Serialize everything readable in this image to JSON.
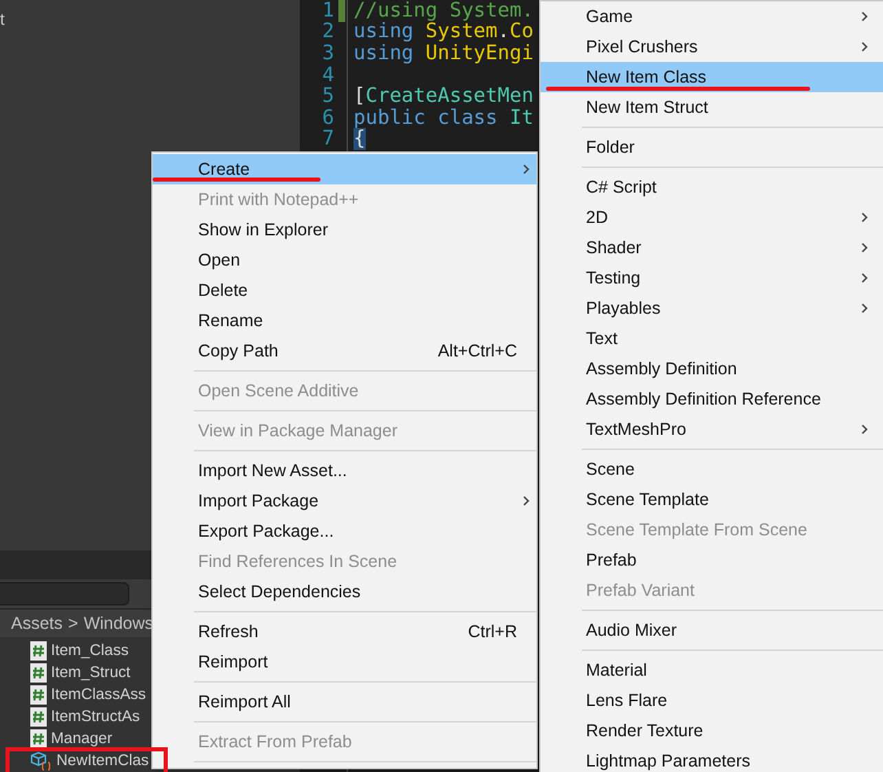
{
  "inspector_panel": {
    "text": "t"
  },
  "code_editor": {
    "lines": [
      {
        "number": "1",
        "changed": true,
        "selected": false,
        "tokens": [
          {
            "kind": "comment",
            "text": "//using System."
          }
        ]
      },
      {
        "number": "2",
        "changed": false,
        "selected": false,
        "tokens": [
          {
            "kind": "keyword",
            "text": "using"
          },
          {
            "kind": "type",
            "text": " System"
          },
          {
            "kind": "plain",
            "text": "."
          },
          {
            "kind": "type",
            "text": "Co"
          }
        ]
      },
      {
        "number": "3",
        "changed": false,
        "selected": false,
        "tokens": [
          {
            "kind": "keyword",
            "text": "using"
          },
          {
            "kind": "type",
            "text": " UnityEngi"
          }
        ]
      },
      {
        "number": "4",
        "changed": false,
        "selected": false
      },
      {
        "number": "5",
        "changed": false,
        "selected": false,
        "tokens": [
          {
            "kind": "plain",
            "text": "["
          },
          {
            "kind": "class",
            "text": "CreateAssetMen"
          }
        ]
      },
      {
        "number": "6",
        "changed": false,
        "selected": false,
        "tokens": [
          {
            "kind": "keyword",
            "text": "public"
          },
          {
            "kind": "keyword",
            "text": " class"
          },
          {
            "kind": "class",
            "text": " It"
          }
        ]
      },
      {
        "number": "7",
        "changed": false,
        "selected": true,
        "tokens": [
          {
            "kind": "plain",
            "text": "{"
          }
        ]
      }
    ]
  },
  "project_panel": {
    "breadcrumb": [
      {
        "label": "Assets"
      },
      {
        "label": "Windows"
      }
    ],
    "separator": ">",
    "assets": [
      {
        "name": "Item_Class",
        "kind": "script",
        "annotated": false
      },
      {
        "name": "Item_Struct",
        "kind": "script",
        "annotated": false
      },
      {
        "name": "ItemClassAss",
        "kind": "script",
        "annotated": false
      },
      {
        "name": "ItemStructAs",
        "kind": "script",
        "annotated": false
      },
      {
        "name": "Manager",
        "kind": "script",
        "annotated": false
      },
      {
        "name": "NewItemClas",
        "kind": "asset",
        "annotated": true
      }
    ]
  },
  "context_menu": {
    "items": [
      {
        "kind": "item",
        "label": "Create",
        "submenu": true,
        "disabled": false,
        "selected": true,
        "annotated": true
      },
      {
        "kind": "item",
        "label": "Print with Notepad++",
        "submenu": false,
        "disabled": true,
        "selected": false,
        "annotated": false
      },
      {
        "kind": "item",
        "label": "Show in Explorer",
        "submenu": false,
        "disabled": false,
        "selected": false,
        "annotated": false
      },
      {
        "kind": "item",
        "label": "Open",
        "submenu": false,
        "disabled": false,
        "selected": false,
        "annotated": false
      },
      {
        "kind": "item",
        "label": "Delete",
        "submenu": false,
        "disabled": false,
        "selected": false,
        "annotated": false
      },
      {
        "kind": "item",
        "label": "Rename",
        "submenu": false,
        "disabled": false,
        "selected": false,
        "annotated": false
      },
      {
        "kind": "item",
        "label": "Copy Path",
        "shortcut": "Alt+Ctrl+C",
        "submenu": false,
        "disabled": false,
        "selected": false,
        "annotated": false
      },
      {
        "kind": "separator"
      },
      {
        "kind": "item",
        "label": "Open Scene Additive",
        "submenu": false,
        "disabled": true,
        "selected": false,
        "annotated": false
      },
      {
        "kind": "separator"
      },
      {
        "kind": "item",
        "label": "View in Package Manager",
        "submenu": false,
        "disabled": true,
        "selected": false,
        "annotated": false
      },
      {
        "kind": "separator"
      },
      {
        "kind": "item",
        "label": "Import New Asset...",
        "submenu": false,
        "disabled": false,
        "selected": false,
        "annotated": false
      },
      {
        "kind": "item",
        "label": "Import Package",
        "submenu": true,
        "disabled": false,
        "selected": false,
        "annotated": false
      },
      {
        "kind": "item",
        "label": "Export Package...",
        "submenu": false,
        "disabled": false,
        "selected": false,
        "annotated": false
      },
      {
        "kind": "item",
        "label": "Find References In Scene",
        "submenu": false,
        "disabled": true,
        "selected": false,
        "annotated": false
      },
      {
        "kind": "item",
        "label": "Select Dependencies",
        "submenu": false,
        "disabled": false,
        "selected": false,
        "annotated": false
      },
      {
        "kind": "separator"
      },
      {
        "kind": "item",
        "label": "Refresh",
        "shortcut": "Ctrl+R",
        "submenu": false,
        "disabled": false,
        "selected": false,
        "annotated": false
      },
      {
        "kind": "item",
        "label": "Reimport",
        "submenu": false,
        "disabled": false,
        "selected": false,
        "annotated": false
      },
      {
        "kind": "separator"
      },
      {
        "kind": "item",
        "label": "Reimport All",
        "submenu": false,
        "disabled": false,
        "selected": false,
        "annotated": false
      },
      {
        "kind": "separator"
      },
      {
        "kind": "item",
        "label": "Extract From Prefab",
        "submenu": false,
        "disabled": true,
        "selected": false,
        "annotated": false
      },
      {
        "kind": "separator"
      }
    ]
  },
  "create_submenu": {
    "items": [
      {
        "kind": "item",
        "label": "Game",
        "submenu": true,
        "disabled": false,
        "selected": false,
        "annotated": false
      },
      {
        "kind": "item",
        "label": "Pixel Crushers",
        "submenu": true,
        "disabled": false,
        "selected": false,
        "annotated": false
      },
      {
        "kind": "item",
        "label": "New Item Class",
        "submenu": false,
        "disabled": false,
        "selected": true,
        "annotated": true
      },
      {
        "kind": "item",
        "label": "New Item Struct",
        "submenu": false,
        "disabled": false,
        "selected": false,
        "annotated": false
      },
      {
        "kind": "separator"
      },
      {
        "kind": "item",
        "label": "Folder",
        "submenu": false,
        "disabled": false,
        "selected": false,
        "annotated": false
      },
      {
        "kind": "separator"
      },
      {
        "kind": "item",
        "label": "C# Script",
        "submenu": false,
        "disabled": false,
        "selected": false,
        "annotated": false
      },
      {
        "kind": "item",
        "label": "2D",
        "submenu": true,
        "disabled": false,
        "selected": false,
        "annotated": false
      },
      {
        "kind": "item",
        "label": "Shader",
        "submenu": true,
        "disabled": false,
        "selected": false,
        "annotated": false
      },
      {
        "kind": "item",
        "label": "Testing",
        "submenu": true,
        "disabled": false,
        "selected": false,
        "annotated": false
      },
      {
        "kind": "item",
        "label": "Playables",
        "submenu": true,
        "disabled": false,
        "selected": false,
        "annotated": false
      },
      {
        "kind": "item",
        "label": "Text",
        "submenu": false,
        "disabled": false,
        "selected": false,
        "annotated": false
      },
      {
        "kind": "item",
        "label": "Assembly Definition",
        "submenu": false,
        "disabled": false,
        "selected": false,
        "annotated": false
      },
      {
        "kind": "item",
        "label": "Assembly Definition Reference",
        "submenu": false,
        "disabled": false,
        "selected": false,
        "annotated": false
      },
      {
        "kind": "item",
        "label": "TextMeshPro",
        "submenu": true,
        "disabled": false,
        "selected": false,
        "annotated": false
      },
      {
        "kind": "separator"
      },
      {
        "kind": "item",
        "label": "Scene",
        "submenu": false,
        "disabled": false,
        "selected": false,
        "annotated": false
      },
      {
        "kind": "item",
        "label": "Scene Template",
        "submenu": false,
        "disabled": false,
        "selected": false,
        "annotated": false
      },
      {
        "kind": "item",
        "label": "Scene Template From Scene",
        "submenu": false,
        "disabled": true,
        "selected": false,
        "annotated": false
      },
      {
        "kind": "item",
        "label": "Prefab",
        "submenu": false,
        "disabled": false,
        "selected": false,
        "annotated": false
      },
      {
        "kind": "item",
        "label": "Prefab Variant",
        "submenu": false,
        "disabled": true,
        "selected": false,
        "annotated": false
      },
      {
        "kind": "separator"
      },
      {
        "kind": "item",
        "label": "Audio Mixer",
        "submenu": false,
        "disabled": false,
        "selected": false,
        "annotated": false
      },
      {
        "kind": "separator"
      },
      {
        "kind": "item",
        "label": "Material",
        "submenu": false,
        "disabled": false,
        "selected": false,
        "annotated": false
      },
      {
        "kind": "item",
        "label": "Lens Flare",
        "submenu": false,
        "disabled": false,
        "selected": false,
        "annotated": false
      },
      {
        "kind": "item",
        "label": "Render Texture",
        "submenu": false,
        "disabled": false,
        "selected": false,
        "annotated": false
      },
      {
        "kind": "item",
        "label": "Lightmap Parameters",
        "submenu": false,
        "disabled": false,
        "selected": false,
        "annotated": false
      }
    ]
  }
}
